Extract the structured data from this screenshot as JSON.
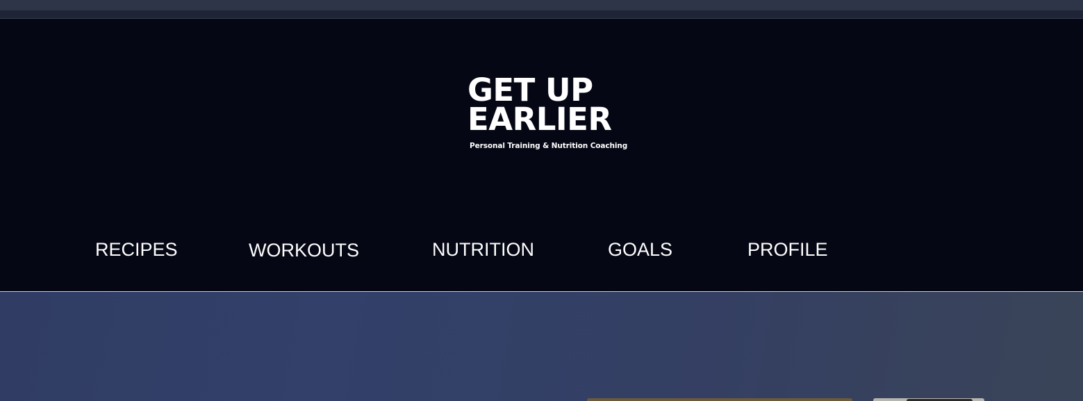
{
  "brand": {
    "line1": "GET UP",
    "line2": "EARLIER",
    "tagline": "Personal Training & Nutrition Coaching"
  },
  "nav": {
    "items": [
      {
        "label": "RECIPES"
      },
      {
        "label": "WORKOUTS"
      },
      {
        "label": "NUTRITION"
      },
      {
        "label": "GOALS"
      },
      {
        "label": "PROFILE"
      }
    ]
  },
  "colors": {
    "header_background": "#050814",
    "hero_background": "#32406a",
    "text": "#ffffff"
  }
}
